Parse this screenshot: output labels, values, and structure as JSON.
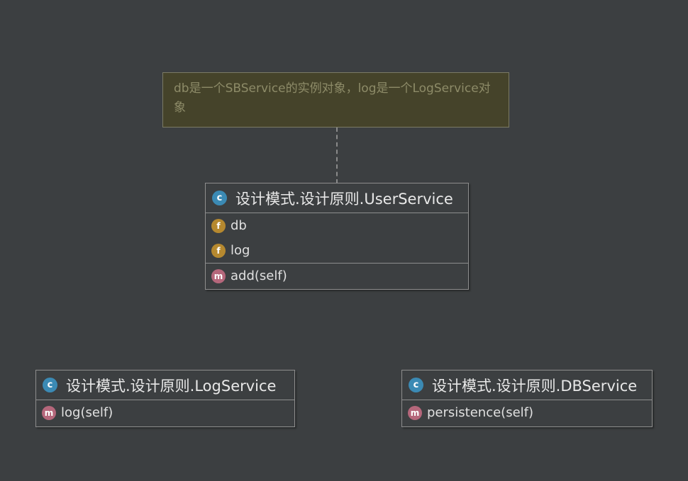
{
  "note": {
    "text": "db是一个SBService的实例对象，log是一个LogService对象"
  },
  "icons": {
    "class_glyph": "c",
    "field_glyph": "f",
    "method_glyph": "m",
    "class_color": "#3b8ab4",
    "field_color": "#b6892f",
    "method_color": "#b5677b"
  },
  "classes": {
    "user_service": {
      "name": "设计模式.设计原则.UserService",
      "fields": [
        "db",
        "log"
      ],
      "methods": [
        "add(self)"
      ]
    },
    "log_service": {
      "name": "设计模式.设计原则.LogService",
      "methods": [
        "log(self)"
      ]
    },
    "db_service": {
      "name": "设计模式.设计原则.DBService",
      "methods": [
        "persistence(self)"
      ]
    }
  }
}
